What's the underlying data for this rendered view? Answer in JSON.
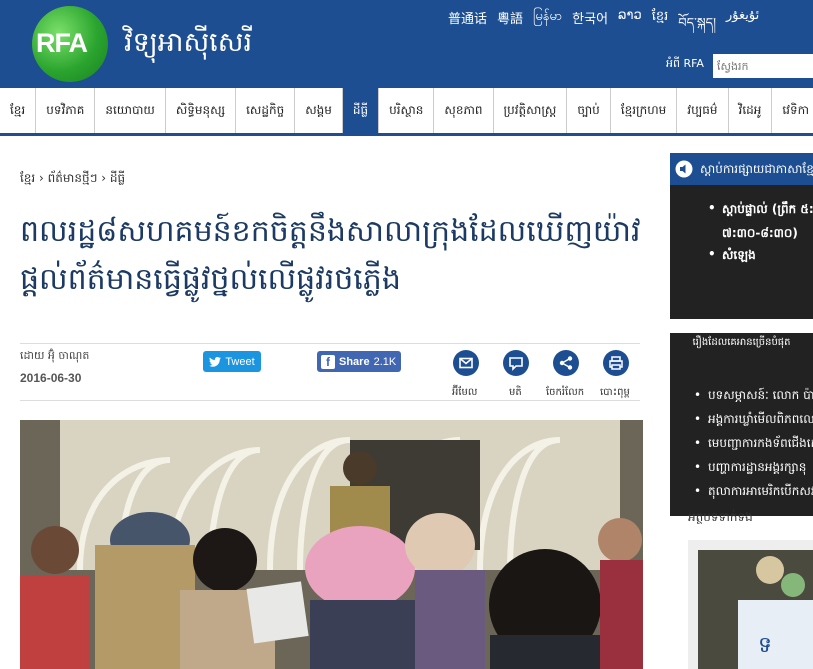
{
  "header": {
    "logo_text": "RFA",
    "site_name": "វិទ្យុអាស៊ីសេរី",
    "languages": [
      "普通话",
      "粵語",
      "မြန်မာ",
      "한국어",
      "ລາວ",
      "ខ្មែរ",
      "བོད་སྐད།",
      "ئۇيغۇر"
    ],
    "about": "អំពី RFA",
    "search_placeholder": "ស្វែងរក"
  },
  "nav": {
    "items": [
      "ខ្មែរ",
      "បទវិភាគ",
      "នយោបាយ",
      "សិទ្ធិមនុស្ស",
      "សេដ្ឋកិច្ច",
      "សង្គម",
      "ដីធ្លី",
      "បរិស្ថាន",
      "សុខភាព",
      "ប្រវត្តិសាស្ត្រ",
      "ច្បាប់",
      "ខ្មែរក្រហម",
      "វប្បធម៌",
      "វិដេអូ",
      "វេទិកា"
    ],
    "active_index": 6
  },
  "article": {
    "breadcrumb": "ខ្មែរ › ព័ត៌មានថ្មីៗ › ដីធ្លី",
    "headline": "ពលរដ្ឋ៨សហគមន៍ខកចិត្តនឹងសាលាក្រុងដែលឃើញយ៉ាវផ្ដល់ព័ត៌មានធ្វើផ្លូវថ្នល់លើផ្លូវរថភ្លើង",
    "byline": "ដោយ អ៊ុំ ចាណុត",
    "date": "2016-06-30",
    "tweet_label": "Tweet",
    "share_label": "Share",
    "share_count": "2.1K",
    "tools": [
      "អ៊ីមែល",
      "មតិ",
      "ចែករំលែក",
      "បោះពុម្ព"
    ]
  },
  "sidebar": {
    "radio_title": "ស្ដាប់ការផ្សាយជាភាសាខ្មែរ",
    "radio_items": [
      "ស្ដាប់ផ្ទាល់ (ព្រឹក ៥:៣០-៦:៣០ ល្ងាច ៧:៣០-៨:៣០)",
      "សំឡេង"
    ],
    "radio_time": "៧:៣០-៨:៣០)",
    "popular_title": "រឿងដែលគេអានច្រើនបំផុត",
    "popular_items": [
      "បទសម្ភាសន៍ៈ លោក ប៉ាន់ សុភ័ណ្ឌ",
      "អង្គការឃ្លាំមើលពិភពលោក",
      "មេបញ្ជាការកងទ័ពជើងគោក",
      "បញ្ហាការដ្ឋានអង្គរក្សានុ",
      "តុលាការអាមេរិកបើកសវនាការ"
    ],
    "section_label": "អត្ថបទទាក់ទង"
  }
}
